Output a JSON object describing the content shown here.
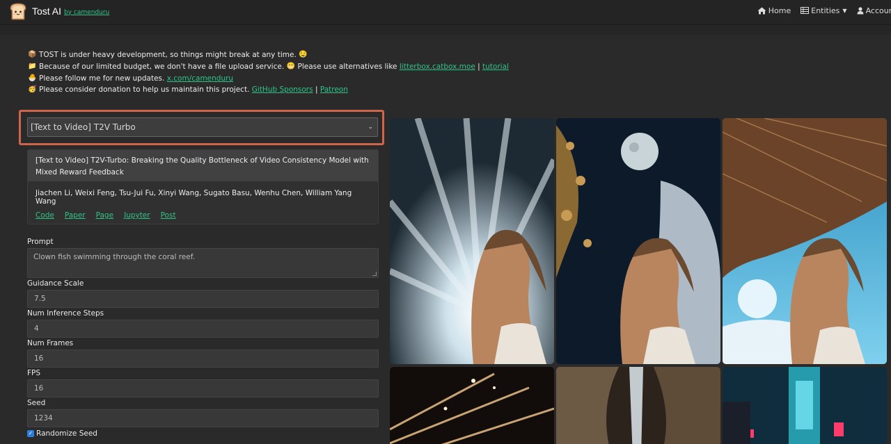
{
  "brand": {
    "name": "Tost AI",
    "by": "by camenduru"
  },
  "nav": {
    "home": "Home",
    "entities": "Entities",
    "account": "Account"
  },
  "notices": [
    {
      "icon": "package-icon",
      "text": "TOST is under heavy development, so things might break at any time.",
      "suffix_icon": "drooling-face-icon"
    },
    {
      "icon": "folder-icon",
      "text": "Because of our limited budget, we don't have a file upload service.",
      "mid_icon": "grimace-face-icon",
      "text2": "Please use alternatives like",
      "link1": "litterbox.catbox.moe",
      "sep": "|",
      "link2": "tutorial"
    },
    {
      "icon": "hatching-chick-icon",
      "text": "Please follow me for new updates.",
      "link1": "x.com/camenduru"
    },
    {
      "icon": "partying-face-icon",
      "text": "Please consider donation to help us maintain this project.",
      "link1": "GitHub Sponsors",
      "sep": "|",
      "link2": "Patreon"
    }
  ],
  "model_select": {
    "value": "[Text to Video] T2V Turbo"
  },
  "card": {
    "title": "[Text to Video] T2V-Turbo: Breaking the Quality Bottleneck of Video Consistency Model with Mixed Reward Feedback",
    "authors": "Jiachen Li, Weixi Feng, Tsu-Jui Fu, Xinyi Wang, Sugato Basu, Wenhu Chen, William Yang Wang",
    "links": [
      "Code",
      "Paper",
      "Page",
      "Jupyter",
      "Post"
    ]
  },
  "form": {
    "prompt_label": "Prompt",
    "prompt_value": "Clown fish swimming through the coral reef.",
    "guidance_label": "Guidance Scale",
    "guidance_value": "7.5",
    "steps_label": "Num Inference Steps",
    "steps_value": "4",
    "frames_label": "Num Frames",
    "frames_value": "16",
    "fps_label": "FPS",
    "fps_value": "16",
    "seed_label": "Seed",
    "seed_value": "1234",
    "randomize_label": "Randomize Seed",
    "randomize_checked": true
  },
  "colors": {
    "accent_link": "#2fc48a",
    "highlight_border": "#d0654a",
    "checkbox": "#2a7de1"
  }
}
